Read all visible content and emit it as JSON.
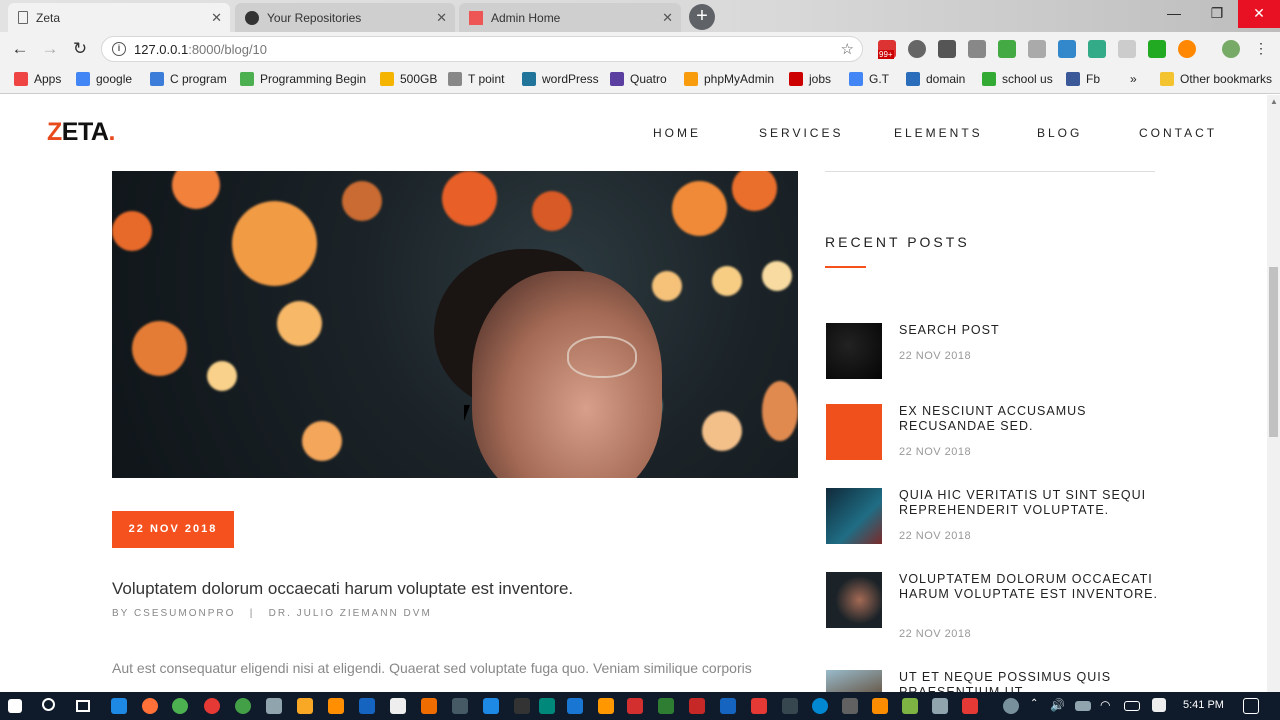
{
  "browser": {
    "tabs": [
      {
        "title": "Zeta",
        "active": true
      },
      {
        "title": "Your Repositories",
        "active": false
      },
      {
        "title": "Admin Home",
        "active": false
      }
    ],
    "new_tab": "+",
    "window_controls": {
      "minimize": "—",
      "maximize": "❐",
      "close": "✕"
    },
    "nav": {
      "back": "←",
      "forward": "→",
      "reload": "↻"
    },
    "url_host": "127.0.0.1",
    "url_path": ":8000/blog/10",
    "info_icon": "i",
    "star": "☆",
    "extension_badge": "99+"
  },
  "bookmarks": [
    {
      "label": "Apps",
      "color": "#e44"
    },
    {
      "label": "google",
      "color": "#4285f4"
    },
    {
      "label": "C program",
      "color": "#3b7dd8"
    },
    {
      "label": "Programming Begin",
      "color": "#4caf50"
    },
    {
      "label": "500GB",
      "color": "#f4b400"
    },
    {
      "label": "T point",
      "color": "#888"
    },
    {
      "label": "wordPress",
      "color": "#21759b"
    },
    {
      "label": "Quatro",
      "color": "#5b3fa0"
    },
    {
      "label": "phpMyAdmin",
      "color": "#f89c0e"
    },
    {
      "label": "jobs",
      "color": "#c00"
    },
    {
      "label": "G.T",
      "color": "#4285f4"
    },
    {
      "label": "domain",
      "color": "#2a6ebb"
    },
    {
      "label": "school us",
      "color": "#3a3"
    },
    {
      "label": "Fb",
      "color": "#3b5998"
    },
    {
      "label": "»",
      "color": ""
    },
    {
      "label": "Other bookmarks",
      "color": "#f4c430"
    }
  ],
  "site": {
    "logo": {
      "z": "Z",
      "rest": "ETA",
      "dot": "."
    },
    "nav": [
      "HOME",
      "SERVICES",
      "ELEMENTS",
      "BLOG",
      "CONTACT"
    ],
    "post": {
      "date": "22 NOV 2018",
      "title": "Voluptatem dolorum occaecati harum voluptate est inventore.",
      "meta": "BY CSESUMONPRO   |   DR. JULIO ZIEMANN DVM",
      "excerpt": "Aut est consequatur eligendi nisi at eligendi. Quaerat sed voluptate fuga quo. Veniam similique corporis"
    },
    "sidebar": {
      "recent_heading": "RECENT POSTS",
      "recent_posts": [
        {
          "title": "SEARCH POST",
          "date": "22 NOV 2018"
        },
        {
          "title": "EX NESCIUNT ACCUSAMUS RECUSANDAE SED.",
          "date": "22 NOV 2018"
        },
        {
          "title": "QUIA HIC VERITATIS UT SINT SEQUI REPREHENDERIT VOLUPTATE.",
          "date": "22 NOV 2018"
        },
        {
          "title": "VOLUPTATEM DOLORUM OCCAECATI HARUM VOLUPTATE EST INVENTORE.",
          "date": "22 NOV 2018"
        },
        {
          "title": "UT ET NEQUE POSSIMUS QUIS PRAESENTIUM UT.",
          "date": ""
        }
      ]
    }
  },
  "taskbar": {
    "clock": "5:41 PM"
  }
}
